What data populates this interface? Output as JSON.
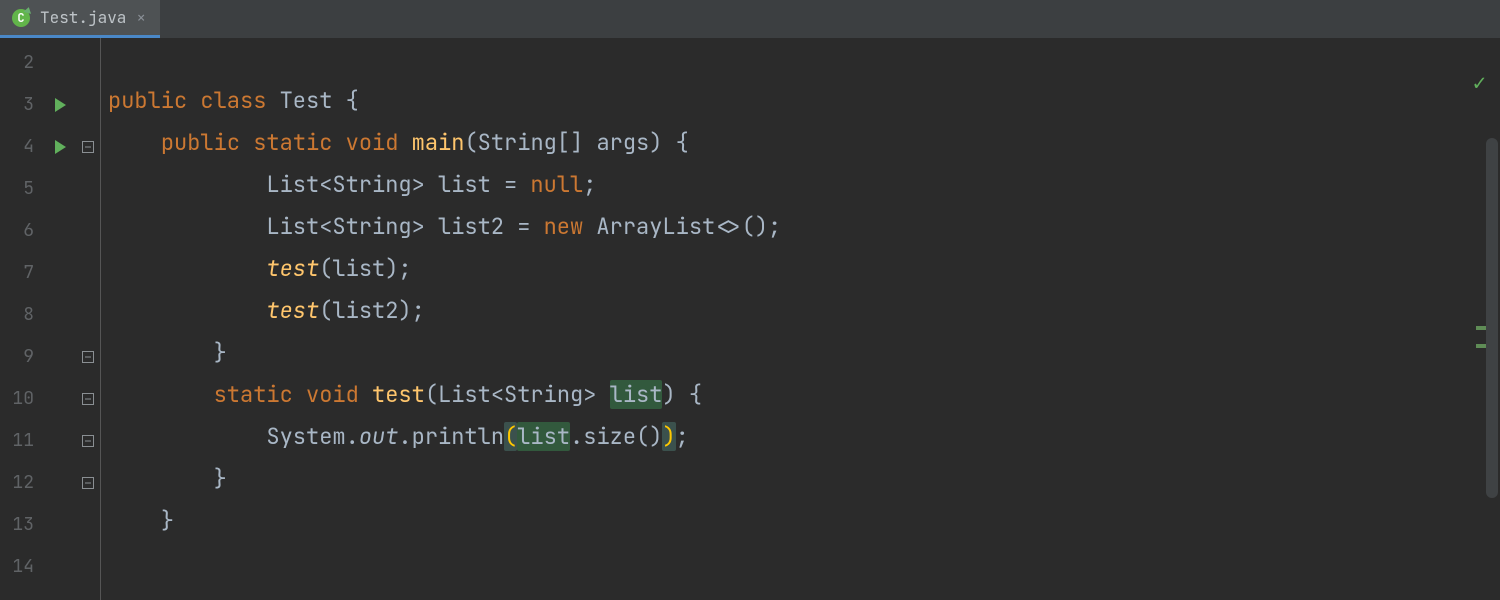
{
  "tab": {
    "icon_letter": "C",
    "filename": "Test.java",
    "close": "×"
  },
  "gutter": {
    "line_numbers": [
      "2",
      "3",
      "4",
      "5",
      "6",
      "7",
      "8",
      "9",
      "10",
      "11",
      "12",
      "13",
      "14"
    ],
    "run_markers": [
      false,
      true,
      true,
      false,
      false,
      false,
      false,
      false,
      false,
      false,
      false,
      false,
      false
    ],
    "fold_markers": [
      "none",
      "none",
      "open",
      "none",
      "none",
      "none",
      "none",
      "close",
      "open",
      "none",
      "close",
      "none",
      "none"
    ]
  },
  "code": {
    "l2": "",
    "l3": {
      "i0": "",
      "kw": "public class ",
      "rest": "Test {"
    },
    "l4": {
      "i1": "    ",
      "kw1": "public static void ",
      "fn": "main",
      "rest": "(String[] args) {"
    },
    "l5": {
      "i2": "            ",
      "t1": "List<String> list = ",
      "kw": "null",
      "t2": ";"
    },
    "l6": {
      "i2": "            ",
      "t1": "List<String> list2 = ",
      "kw": "new ",
      "t2": "ArrayList<>();"
    },
    "l7": {
      "i2": "            ",
      "fn": "test",
      "t": "(list);"
    },
    "l8": {
      "i2": "            ",
      "fn": "test",
      "t": "(list2);"
    },
    "l9": {
      "i2": "        ",
      "t": "}"
    },
    "l10": {
      "i2": "        ",
      "kw": "static void ",
      "fn": "test",
      "t1": "(List<String> ",
      "hl": "list",
      "t2": ") {"
    },
    "l11": {
      "i2": "            ",
      "t1": "System.",
      "it": "out",
      "t2": ".println",
      "p1": "(",
      "hl": "list",
      "t3": ".size()",
      "p2": ")",
      "t4": ";"
    },
    "l12": {
      "i2": "        ",
      "t": "}"
    },
    "l13": {
      "i1": "    ",
      "t": "}"
    },
    "l14": ""
  },
  "status": {
    "check": "✓"
  }
}
